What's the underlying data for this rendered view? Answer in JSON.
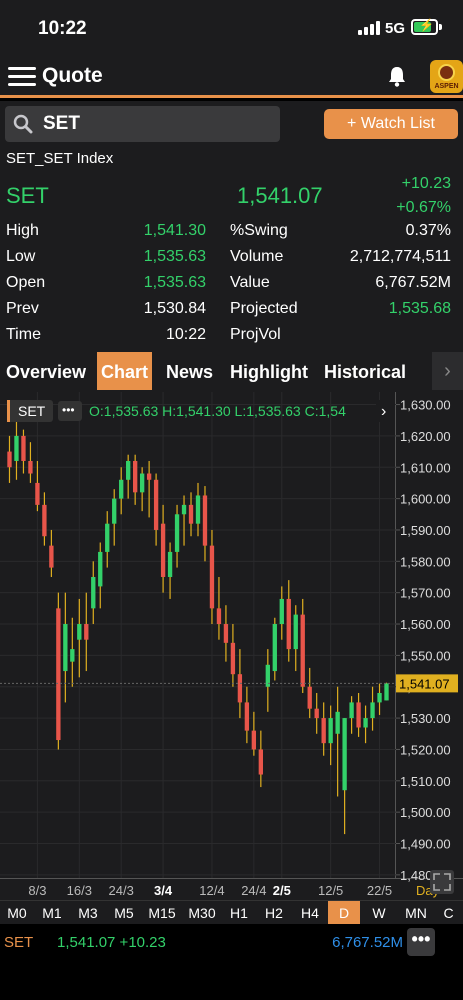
{
  "status_bar": {
    "time": "10:22",
    "network": "5G"
  },
  "nav": {
    "title": "Quote",
    "logo_text": "ASPEN"
  },
  "search": {
    "value": "SET",
    "watch_label": "+ Watch List"
  },
  "quote": {
    "full_name": "SET_SET Index",
    "symbol": "SET",
    "last": "1,541.07",
    "change": "+10.23",
    "change_pct": "+0.67%",
    "rows": [
      {
        "l1": "High",
        "v1": "1,541.30",
        "v1_green": true,
        "l2": "%Swing",
        "v2": "0.37%",
        "v2_green": false
      },
      {
        "l1": "Low",
        "v1": "1,535.63",
        "v1_green": true,
        "l2": "Volume",
        "v2": "2,712,774,511",
        "v2_green": false
      },
      {
        "l1": "Open",
        "v1": "1,535.63",
        "v1_green": true,
        "l2": "Value",
        "v2": "6,767.52M",
        "v2_green": false
      },
      {
        "l1": "Prev",
        "v1": "1,530.84",
        "v1_green": false,
        "l2": "Projected",
        "v2": "1,535.68",
        "v2_green": true
      },
      {
        "l1": "Time",
        "v1": "10:22",
        "v1_green": false,
        "l2": "ProjVol",
        "v2": "",
        "v2_green": false
      }
    ]
  },
  "tabs": [
    "Overview",
    "Chart",
    "News",
    "Highlight",
    "Historical"
  ],
  "active_tab": "Chart",
  "chart_header": {
    "symbol": "SET",
    "more": "•••",
    "ohlc": "O:1,535.63  H:1,541.30  L:1,535.63  C:1,54"
  },
  "chart_data": {
    "type": "candlestick",
    "y_ticks": [
      1630,
      1620,
      1610,
      1600,
      1590,
      1580,
      1570,
      1560,
      1550,
      1540,
      1530,
      1520,
      1510,
      1500,
      1490,
      1480
    ],
    "y_tick_labels": [
      "1,630.00",
      "1,620.00",
      "1,610.00",
      "1,600.00",
      "1,590.00",
      "1,580.00",
      "1,570.00",
      "1,560.00",
      "1,550.00",
      "1,540.00",
      "1,530.00",
      "1,520.00",
      "1,510.00",
      "1,500.00",
      "1,490.00",
      "1,480.00"
    ],
    "ylim": [
      1479,
      1634
    ],
    "last_price_label": "1,541.07",
    "last_price": 1541.07,
    "x_labels": [
      {
        "label": "8/3",
        "index": 4,
        "bold": false
      },
      {
        "label": "16/3",
        "index": 10,
        "bold": false
      },
      {
        "label": "24/3",
        "index": 16,
        "bold": false
      },
      {
        "label": "3/4",
        "index": 22,
        "bold": true
      },
      {
        "label": "12/4",
        "index": 29,
        "bold": false
      },
      {
        "label": "24/4",
        "index": 35,
        "bold": false
      },
      {
        "label": "2/5",
        "index": 39,
        "bold": true
      },
      {
        "label": "12/5",
        "index": 46,
        "bold": false
      },
      {
        "label": "22/5",
        "index": 53,
        "bold": false
      }
    ],
    "candles": [
      [
        1615,
        1620,
        1605,
        1610
      ],
      [
        1612,
        1625,
        1606,
        1620
      ],
      [
        1620,
        1622,
        1608,
        1612
      ],
      [
        1612,
        1618,
        1605,
        1608
      ],
      [
        1605,
        1612,
        1596,
        1598
      ],
      [
        1598,
        1602,
        1585,
        1588
      ],
      [
        1585,
        1590,
        1575,
        1578
      ],
      [
        1565,
        1570,
        1520,
        1523
      ],
      [
        1545,
        1570,
        1535,
        1560
      ],
      [
        1548,
        1562,
        1540,
        1552
      ],
      [
        1555,
        1568,
        1543,
        1560
      ],
      [
        1560,
        1570,
        1545,
        1555
      ],
      [
        1565,
        1580,
        1560,
        1575
      ],
      [
        1572,
        1586,
        1565,
        1583
      ],
      [
        1583,
        1596,
        1578,
        1592
      ],
      [
        1592,
        1603,
        1585,
        1600
      ],
      [
        1600,
        1610,
        1595,
        1606
      ],
      [
        1606,
        1614,
        1600,
        1612
      ],
      [
        1612,
        1614,
        1598,
        1602
      ],
      [
        1602,
        1610,
        1596,
        1608
      ],
      [
        1608,
        1612,
        1594,
        1606
      ],
      [
        1606,
        1608,
        1585,
        1590
      ],
      [
        1592,
        1598,
        1570,
        1575
      ],
      [
        1575,
        1586,
        1568,
        1583
      ],
      [
        1583,
        1598,
        1578,
        1595
      ],
      [
        1595,
        1601,
        1585,
        1598
      ],
      [
        1598,
        1602,
        1588,
        1592
      ],
      [
        1592,
        1605,
        1588,
        1601
      ],
      [
        1601,
        1604,
        1580,
        1585
      ],
      [
        1585,
        1590,
        1560,
        1565
      ],
      [
        1565,
        1575,
        1555,
        1560
      ],
      [
        1560,
        1566,
        1548,
        1554
      ],
      [
        1554,
        1560,
        1540,
        1544
      ],
      [
        1544,
        1552,
        1530,
        1535
      ],
      [
        1535,
        1540,
        1522,
        1526
      ],
      [
        1526,
        1532,
        1518,
        1520
      ],
      [
        1520,
        1526,
        1508,
        1512
      ],
      [
        1540,
        1552,
        1532,
        1547
      ],
      [
        1545,
        1562,
        1542,
        1560
      ],
      [
        1560,
        1572,
        1555,
        1568
      ],
      [
        1568,
        1574,
        1548,
        1552
      ],
      [
        1552,
        1566,
        1545,
        1563
      ],
      [
        1563,
        1568,
        1538,
        1540
      ],
      [
        1540,
        1546,
        1530,
        1533
      ],
      [
        1533,
        1538,
        1525,
        1530
      ],
      [
        1530,
        1535,
        1518,
        1522
      ],
      [
        1522,
        1534,
        1515,
        1530
      ],
      [
        1525,
        1540,
        1505,
        1532
      ],
      [
        1507,
        1530,
        1493,
        1530
      ],
      [
        1530,
        1537,
        1525,
        1535
      ],
      [
        1535,
        1538,
        1524,
        1527
      ],
      [
        1527,
        1534,
        1522,
        1530
      ],
      [
        1530,
        1540,
        1526,
        1535
      ],
      [
        1535,
        1541,
        1531,
        1538
      ],
      [
        1535.63,
        1541.3,
        1535.63,
        1541.07
      ]
    ]
  },
  "timeframes": [
    "M0",
    "M1",
    "M3",
    "M5",
    "M15",
    "M30",
    "H1",
    "H2",
    "H4",
    "D",
    "W",
    "MN",
    "C"
  ],
  "active_timeframe": "D",
  "day_label": "Day",
  "footer": {
    "symbol": "SET",
    "price_change": "1,541.07 +10.23",
    "value": "6,767.52M",
    "more": "•••"
  },
  "colors": {
    "accent": "#e8914a",
    "up": "#33d16a",
    "down": "#e8554a",
    "wick": "#e0b020",
    "value_blue": "#2f8fe8"
  }
}
